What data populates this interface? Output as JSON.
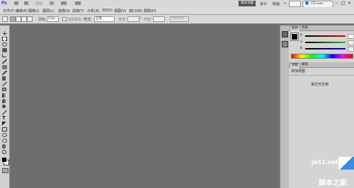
{
  "appbar": {
    "logo": "Ps",
    "workspace_button": "基本功能",
    "design_label": "设计",
    "painting_label": "绘画",
    "more_label": "»",
    "cs_live_label": "CS Live"
  },
  "menus": [
    {
      "label": "文件(F)"
    },
    {
      "label": "编辑(E)"
    },
    {
      "label": "图像(I)"
    },
    {
      "label": "图层(L)"
    },
    {
      "label": "选择(S)"
    },
    {
      "label": "滤镜(T)"
    },
    {
      "label": "分析(A)"
    },
    {
      "label": "3D(D)"
    },
    {
      "label": "视图(V)"
    },
    {
      "label": "窗口(W)"
    },
    {
      "label": "帮助(H)"
    }
  ],
  "options": {
    "feather_label": "羽化:",
    "feather_value": "0 px",
    "antialias_label": "消除锯齿",
    "style_label": "样式:",
    "style_value": "正常",
    "width_label": "宽度:",
    "height_label": "高度:",
    "refine_button": "调整边缘..."
  },
  "color_panel": {
    "tabs": [
      "颜色",
      "色板"
    ],
    "sliders": [
      {
        "label": "R",
        "value": "0",
        "color": "#d02020"
      },
      {
        "label": "G",
        "value": "0",
        "color": "#20a020"
      },
      {
        "label": "B",
        "value": "0",
        "color": "#2040d0"
      }
    ]
  },
  "adjust_panel": {
    "tabs": [
      "调整",
      "蒙版"
    ],
    "title": "添加调整",
    "message": "未打开文档"
  },
  "watermark": {
    "site": "jb51.net",
    "text": "脚本之家"
  }
}
